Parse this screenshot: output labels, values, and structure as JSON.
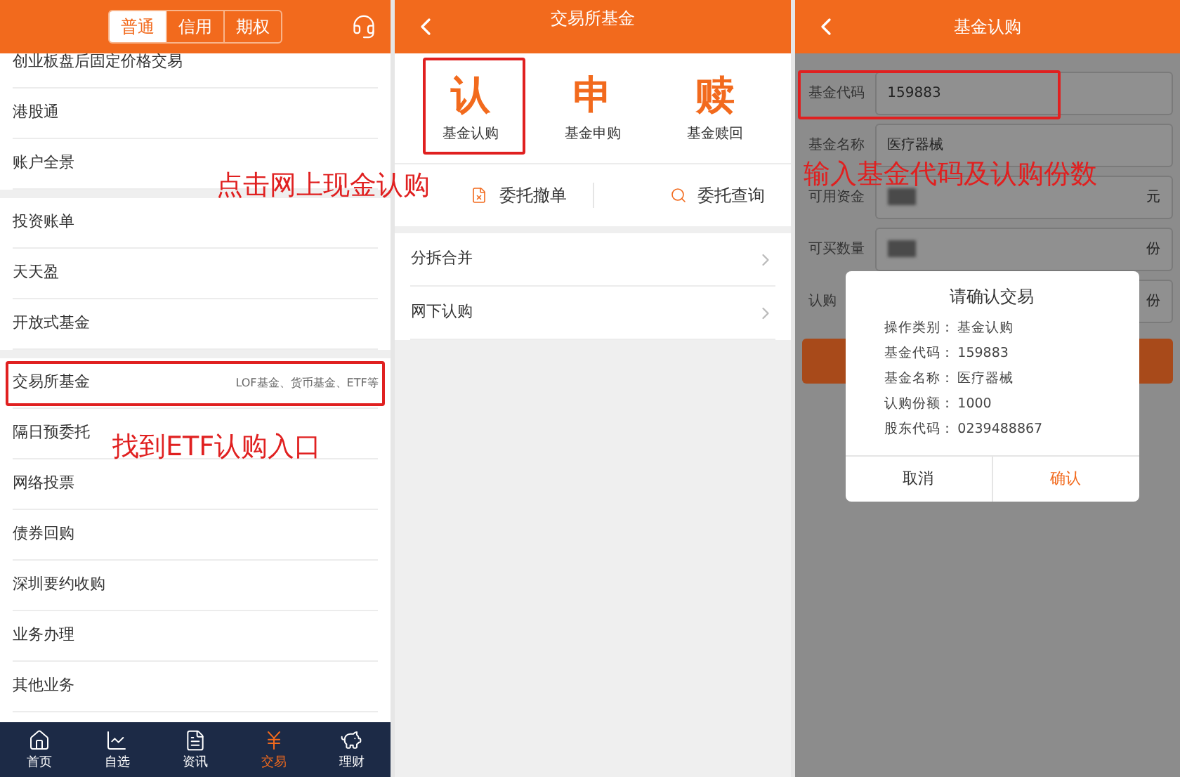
{
  "screen_1": {
    "tabs": [
      {
        "label": "普通",
        "selected": true
      },
      {
        "label": "信用",
        "selected": false
      },
      {
        "label": "期权",
        "selected": false
      }
    ],
    "sections": [
      [
        {
          "label": "创业板盘后固定价格交易"
        },
        {
          "label": "港股通"
        },
        {
          "label": "账户全景"
        }
      ],
      [
        {
          "label": "投资账单"
        },
        {
          "label": "天天盈"
        },
        {
          "label": "开放式基金"
        }
      ],
      [
        {
          "label": "交易所基金",
          "detail": "LOF基金、货币基金、ETF等"
        },
        {
          "label": "隔日预委托"
        },
        {
          "label": "网络投票"
        },
        {
          "label": "债券回购"
        },
        {
          "label": "深圳要约收购"
        },
        {
          "label": "业务办理"
        },
        {
          "label": "其他业务"
        }
      ]
    ],
    "bottom_nav": [
      {
        "label": "首页",
        "selected": false
      },
      {
        "label": "自选",
        "selected": false
      },
      {
        "label": "资讯",
        "selected": false
      },
      {
        "label": "交易",
        "selected": true
      },
      {
        "label": "理财",
        "selected": false
      }
    ]
  },
  "screen_2": {
    "title": "交易所基金",
    "fund_actions": [
      {
        "glyph": "认",
        "label": "基金认购"
      },
      {
        "glyph": "申",
        "label": "基金申购"
      },
      {
        "glyph": "赎",
        "label": "基金赎回"
      }
    ],
    "order_links": [
      {
        "label": "委托撤单"
      },
      {
        "label": "委托查询"
      }
    ],
    "list": [
      {
        "label": "分拆合并"
      },
      {
        "label": "网下认购"
      }
    ]
  },
  "screen_3": {
    "title": "基金认购",
    "form": [
      {
        "label": "基金代码",
        "kind": "value",
        "value": "159883"
      },
      {
        "label": "基金名称",
        "kind": "value",
        "value": "医疗器械"
      },
      {
        "label": "可用资金",
        "kind": "redacted",
        "unit": "元"
      },
      {
        "label": "可买数量",
        "kind": "redacted",
        "unit": "份"
      },
      {
        "label": "认购",
        "kind": "empty",
        "unit": "份"
      }
    ],
    "dialog": {
      "title": "请确认交易",
      "rows": [
        {
          "label": "操作类别：",
          "value": "基金认购"
        },
        {
          "label": "基金代码：",
          "value": "159883"
        },
        {
          "label": "基金名称：",
          "value": "医疗器械"
        },
        {
          "label": "认购份额：",
          "value": "1000"
        },
        {
          "label": "股东代码：",
          "value": "0239488867"
        }
      ],
      "buttons": [
        {
          "label": "取消",
          "primary": false
        },
        {
          "label": "确认",
          "primary": true
        }
      ]
    }
  },
  "annotations": [
    {
      "text": "点击网上现金认购"
    },
    {
      "text": "找到ETF认购入口"
    },
    {
      "text": "输入基金代码及认购份数"
    }
  ]
}
